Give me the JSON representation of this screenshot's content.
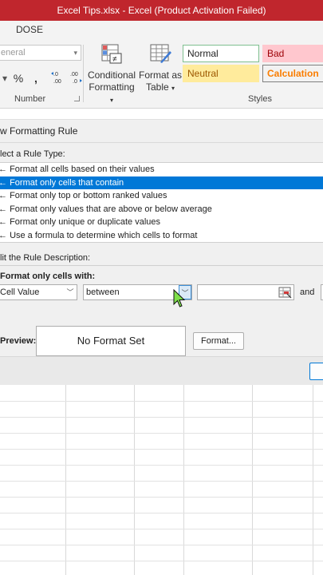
{
  "window": {
    "title": "Excel Tips.xlsx -  Excel (Product Activation Failed)"
  },
  "ribbon": {
    "tab_label": "DOSE",
    "number_format_value": "eneral",
    "number_tools": [
      "$",
      "%",
      ",",
      "←.0 .00",
      ".00 →.0"
    ],
    "number_group_label": "Number",
    "conditional_formatting": {
      "line1": "Conditional",
      "line2": "Formatting"
    },
    "format_as_table": {
      "line1": "Format as",
      "line2": "Table"
    },
    "styles_group_label": "Styles",
    "styles": [
      {
        "label": "Normal",
        "bg": "#ffffff",
        "fg": "#222222",
        "border": "#7fbf8f"
      },
      {
        "label": "Bad",
        "bg": "#ffc7ce",
        "fg": "#9c0006",
        "border": "#ffc7ce"
      },
      {
        "label": "Neutral",
        "bg": "#ffeb9c",
        "fg": "#9c5700",
        "border": "#ffeb9c"
      },
      {
        "label": "Calculation",
        "bg": "#f2f2f2",
        "fg": "#fa7d00",
        "border": "#7f7f7f"
      }
    ]
  },
  "dialog": {
    "title": "w Formatting Rule",
    "select_rule_label": "lect a Rule Type:",
    "rule_types": [
      {
        "label": "Format all cells based on their values",
        "selected": false
      },
      {
        "label": "Format only cells that contain",
        "selected": true
      },
      {
        "label": "Format only top or bottom ranked values",
        "selected": false
      },
      {
        "label": "Format only values that are above or below average",
        "selected": false
      },
      {
        "label": "Format only unique or duplicate values",
        "selected": false
      },
      {
        "label": "Use a formula to determine which cells to format",
        "selected": false
      }
    ],
    "edit_rule_label": "lit the Rule Description:",
    "format_only_label": "Format only cells with:",
    "condition_field": "Cell Value",
    "operator_field": "between",
    "value1": "",
    "and_label": "and",
    "preview_label": "Preview:",
    "preview_text": "No Format Set",
    "format_button": "Format..."
  },
  "colors": {
    "title_bar": "#c0262d",
    "selection": "#0078d7"
  }
}
